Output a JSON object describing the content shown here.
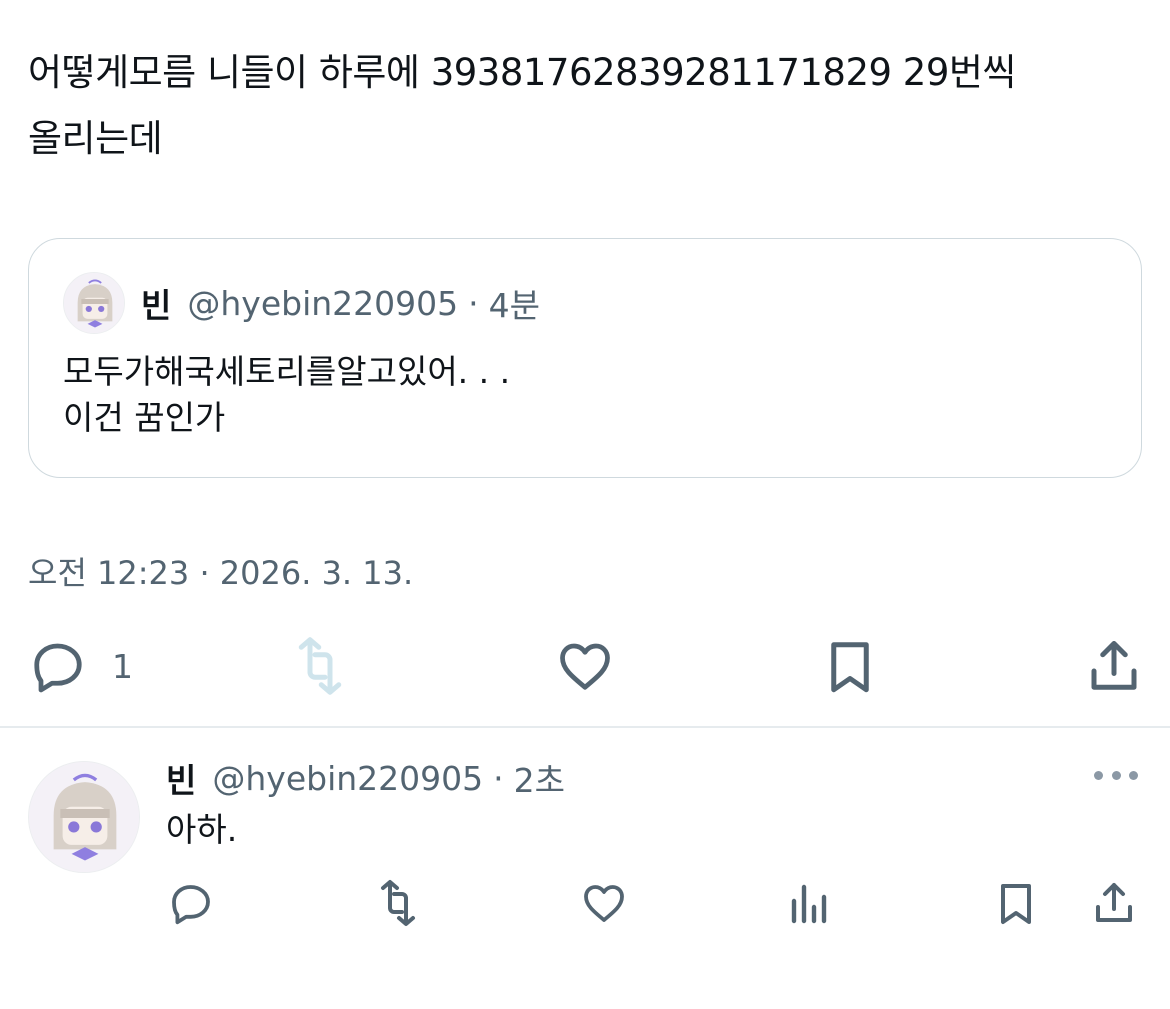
{
  "post": {
    "text_line1": "어떻게모름 니들이 하루에 39381762839281171829 29번씩",
    "text_line2": "올리는데"
  },
  "quote": {
    "name": "빈",
    "handle": "@hyebin220905",
    "separator": "·",
    "time": "4분",
    "body_line1": "모두가해국세토리를알고있어. . .",
    "body_line2": "이건 꿈인가"
  },
  "timestamp": "오전 12:23 · 2026. 3. 13.",
  "actions": {
    "reply_count": "1",
    "retweet_disabled": true,
    "colors": {
      "icon": "#536471",
      "disabled": "#cfe4ec"
    }
  },
  "reply": {
    "name": "빈",
    "handle": "@hyebin220905",
    "separator": "·",
    "time": "2초",
    "body": "아하."
  },
  "icons": [
    "reply-icon",
    "retweet-icon",
    "like-icon",
    "bookmark-icon",
    "share-icon",
    "views-icon",
    "more-icon"
  ]
}
